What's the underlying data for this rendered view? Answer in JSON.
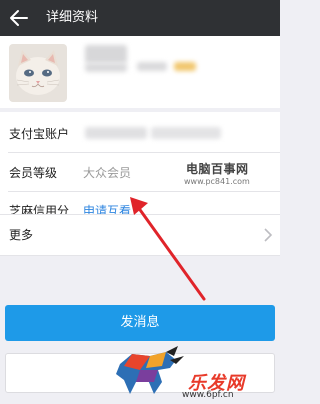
{
  "header": {
    "title": "详细资料"
  },
  "profile": {
    "avatar": "kitten-photo"
  },
  "rows": [
    {
      "label": "支付宝账户",
      "value": ""
    },
    {
      "label": "会员等级",
      "value": "大众会员"
    },
    {
      "label": "芝麻信用分",
      "value": "申请互看"
    }
  ],
  "watermark": {
    "name": "电脑百事网",
    "url": "www.pc841.com"
  },
  "more": {
    "label": "更多"
  },
  "actions": {
    "send_message": "发消息"
  },
  "footer_logo": {
    "name": "乐发网",
    "url": "www.6pf.cn"
  },
  "colors": {
    "header_bg": "#2f3134",
    "link": "#2f86e0",
    "primary_button": "#1e9ae8",
    "annotation_arrow": "#e0242a",
    "logo": "#e83a2a"
  }
}
